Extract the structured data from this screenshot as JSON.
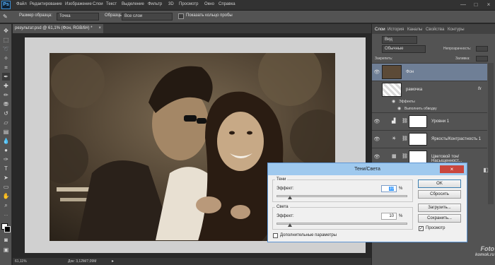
{
  "app": {
    "logo": "Ps"
  },
  "menu": [
    "Файл",
    "Редактирование",
    "Изображение",
    "Слои",
    "Текст",
    "Выделение",
    "Фильтр",
    "3D",
    "Просмотр",
    "Окно",
    "Справка"
  ],
  "window_controls": {
    "minimize": "—",
    "restore": "□",
    "close": "×"
  },
  "options": {
    "sample_size_label": "Размер образца:",
    "sample_size_value": "Точка",
    "samples_label": "Образцы:",
    "samples_value": "Все слои",
    "show_ring_label": "Показать кольцо пробы"
  },
  "document": {
    "tab_title": "результат.psd @ 61,1% (Фон, RGB/8#) *",
    "tab_close": "×"
  },
  "status": {
    "zoom": "61,11%",
    "doc_size": "Док: 3,12М/7,09М"
  },
  "panel": {
    "tabs": [
      "Слои",
      "История",
      "Каналы",
      "Свойства",
      "Контуры"
    ],
    "kind_label": "Вид",
    "blend_mode": "Обычные",
    "opacity_label": "Непрозрачность:",
    "lock_label": "Закрепить:",
    "fill_label": "Заливка:",
    "layers": [
      {
        "name": "Фон",
        "selected": true
      },
      {
        "name": "рамочка",
        "fx": "fx"
      },
      {
        "name": "Эффекты"
      },
      {
        "name": "Выполнить обводку"
      },
      {
        "name": "Уровни 1"
      },
      {
        "name": "Яркость/Контрастность 1"
      },
      {
        "name": "Цветовой тон/Насыщенност..."
      }
    ]
  },
  "dialog": {
    "title": "Тени/Света",
    "shadows_group": "Тени",
    "shadows_effect_label": "Эффект:",
    "shadows_value": "10",
    "shadows_unit": "%",
    "shadows_level": 0.1,
    "highlights_group": "Света",
    "highlights_effect_label": "Эффект:",
    "highlights_value": "10",
    "highlights_unit": "%",
    "highlights_level": 0.1,
    "more_options_label": "Дополнительные параметры",
    "ok_label": "OK",
    "reset_label": "Сбросить",
    "load_label": "Загрузить...",
    "save_label": "Сохранить...",
    "preview_label": "Просмотр",
    "preview_checked": true,
    "close_label": "×"
  },
  "watermark": {
    "line1": "Foto",
    "line2": "komok.ru"
  }
}
